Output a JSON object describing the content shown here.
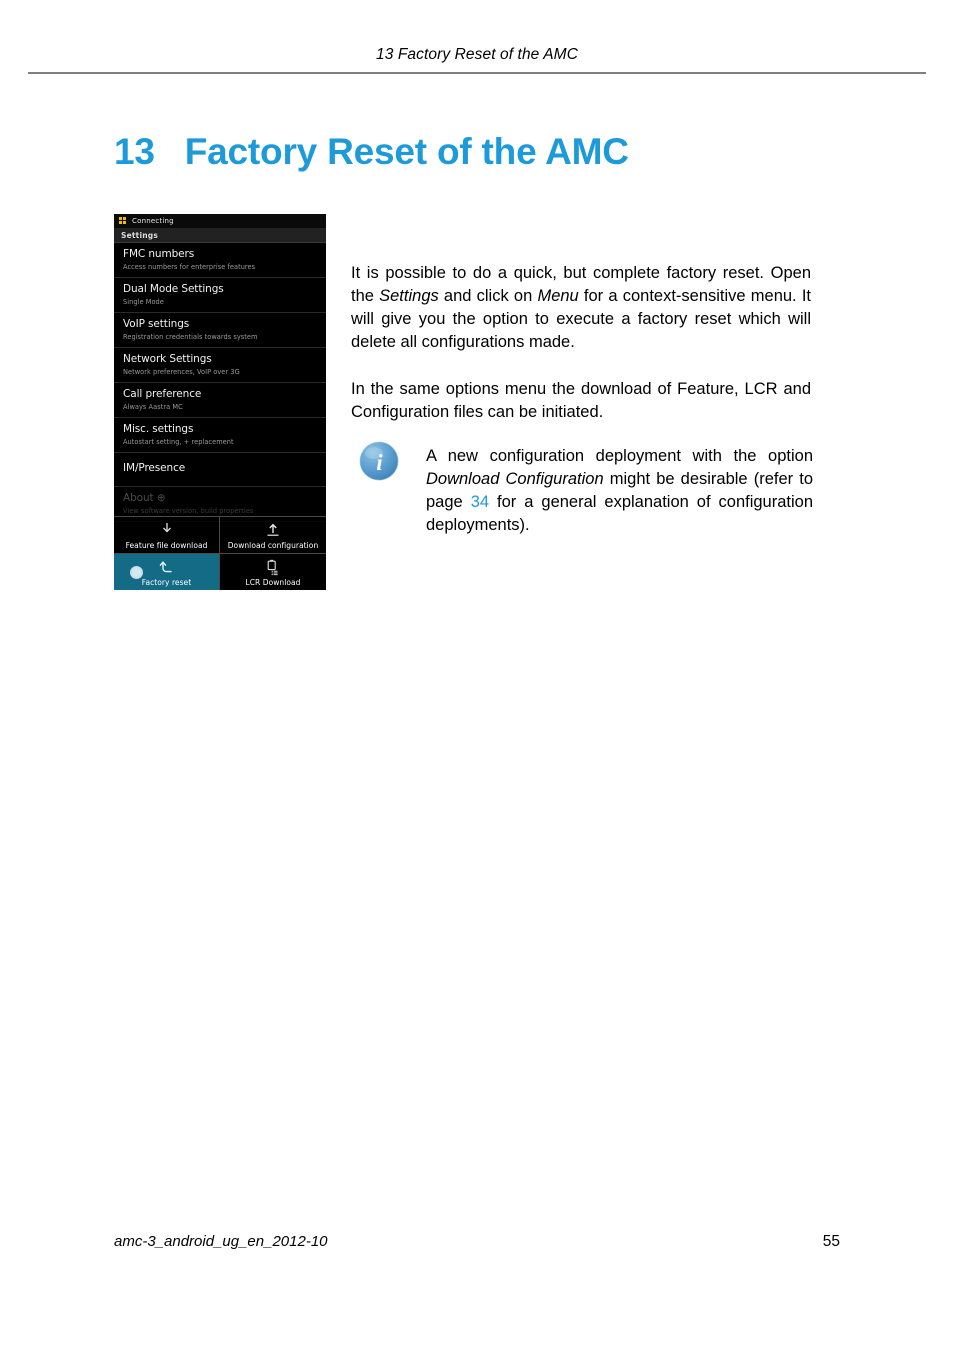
{
  "header": {
    "running_head": "13  Factory Reset of the AMC"
  },
  "chapter": {
    "number": "13",
    "title": "Factory Reset of the AMC",
    "accent_color": "#1d9ad9"
  },
  "screenshot": {
    "statusbar": {
      "icon": "apps-grid-icon",
      "label": "Connecting"
    },
    "titlebar": {
      "label": "Settings"
    },
    "settings_items": [
      {
        "title": "FMC numbers",
        "subtitle": "Access numbers for enterprise features"
      },
      {
        "title": "Dual Mode Settings",
        "subtitle": "Single Mode"
      },
      {
        "title": "VoIP settings",
        "subtitle": "Registration credentials towards system"
      },
      {
        "title": "Network Settings",
        "subtitle": "Network preferences, VoIP over 3G"
      },
      {
        "title": "Call preference",
        "subtitle": "Always Aastra MC"
      },
      {
        "title": "Misc. settings",
        "subtitle": "Autostart setting, + replacement"
      },
      {
        "title": "IM/Presence",
        "subtitle": ""
      },
      {
        "title": "About  ⊕",
        "subtitle": "View software version, build properties"
      }
    ],
    "options_menu": [
      {
        "label": "Feature file download",
        "icon": "download-file-icon",
        "pressed": false
      },
      {
        "label": "Download configuration",
        "icon": "upload-arrow-icon",
        "pressed": false
      },
      {
        "label": "Factory reset",
        "icon": "undo-arrow-icon",
        "pressed": true
      },
      {
        "label": "LCR Download",
        "icon": "document-list-icon",
        "pressed": false
      }
    ],
    "pressed_color": "#136b85"
  },
  "body": {
    "para1_a": "It is possible to do a quick, but complete factory reset. Open the ",
    "para1_em1": "Settings",
    "para1_b": " and click on ",
    "para1_em2": "Menu",
    "para1_c": " for a context-sensitive menu.  It will give you the option to execute a factory reset which will delete all configurations made.",
    "para2": "In the same options menu the download of Feature, LCR and Configuration files can be initiated."
  },
  "note": {
    "icon": "info-icon",
    "text_a": "A new configuration deployment with the option ",
    "text_em": "Download Configuration",
    "text_b": " might be desirable (refer to page ",
    "link": "34",
    "text_c": " for a general explanation of configuration deployments)."
  },
  "footer": {
    "document_id": "amc-3_android_ug_en_2012-10",
    "page_number": "55"
  }
}
